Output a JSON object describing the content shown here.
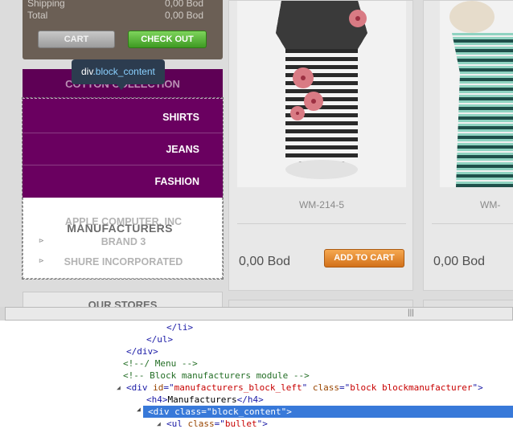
{
  "cart": {
    "shipping_label": "Shipping",
    "shipping_value": "0,00 Bod",
    "total_label": "Total",
    "total_value": "0,00 Bod",
    "cart_button": "CART",
    "checkout_button": "CHECK OUT"
  },
  "menu": {
    "heading": "COTTON COLLECTION",
    "items": [
      {
        "label": "SHIRTS"
      },
      {
        "label": "JEANS"
      },
      {
        "label": "FASHION"
      }
    ]
  },
  "tooltip": {
    "tag": "div",
    "class": ".block_content"
  },
  "manufacturers": {
    "title": "MANUFACTURERS",
    "links": [
      "APPLE COMPUTER, INC",
      "BRAND 3",
      "SHURE INCORPORATED"
    ]
  },
  "stores_heading": "OUR STORES",
  "products": [
    {
      "name": "WM-214-5",
      "price": "0,00 Bod",
      "add_label": "ADD TO CART"
    },
    {
      "name": "WM-",
      "price": "0,00 Bod"
    }
  ],
  "devtools": {
    "lines": [
      {
        "indent": 207,
        "parts": [
          [
            "tag",
            "</li>"
          ]
        ]
      },
      {
        "indent": 182,
        "parts": [
          [
            "tag",
            "</ul>"
          ]
        ]
      },
      {
        "indent": 157,
        "parts": [
          [
            "tag",
            "</div>"
          ]
        ]
      },
      {
        "indent": 153,
        "parts": [
          [
            "cm",
            "<!--/ Menu -->"
          ]
        ]
      },
      {
        "indent": 153,
        "parts": [
          [
            "cm",
            "<!-- Block manufacturers module -->"
          ]
        ]
      },
      {
        "indent": 157,
        "twisty": true,
        "parts": [
          [
            "tag",
            "<div "
          ],
          [
            "an",
            "id"
          ],
          [
            "tag",
            "=\""
          ],
          [
            "av",
            "manufacturers_block_left"
          ],
          [
            "tag",
            "\" "
          ],
          [
            "an",
            "class"
          ],
          [
            "tag",
            "=\""
          ],
          [
            "av",
            "block blockmanufacturer"
          ],
          [
            "tag",
            "\">"
          ]
        ]
      },
      {
        "indent": 182,
        "parts": [
          [
            "tag",
            "<h4>"
          ],
          [
            "tx",
            "Manufacturers"
          ],
          [
            "tag",
            "</h4>"
          ]
        ]
      },
      {
        "indent": 182,
        "twisty": true,
        "selected": true,
        "parts": [
          [
            "tag",
            "<div "
          ],
          [
            "an",
            "class"
          ],
          [
            "tag",
            "=\""
          ],
          [
            "av",
            "block_content"
          ],
          [
            "tag",
            "\">"
          ]
        ]
      },
      {
        "indent": 207,
        "twisty": true,
        "parts": [
          [
            "tag",
            "<ul "
          ],
          [
            "an",
            "class"
          ],
          [
            "tag",
            "=\""
          ],
          [
            "av",
            "bullet"
          ],
          [
            "tag",
            "\">"
          ]
        ]
      }
    ]
  },
  "colors": {
    "menu_bg": "#6a0060",
    "selection": "#3879d9",
    "checkout": "#3e9a22",
    "add_to_cart": "#d2711a"
  }
}
